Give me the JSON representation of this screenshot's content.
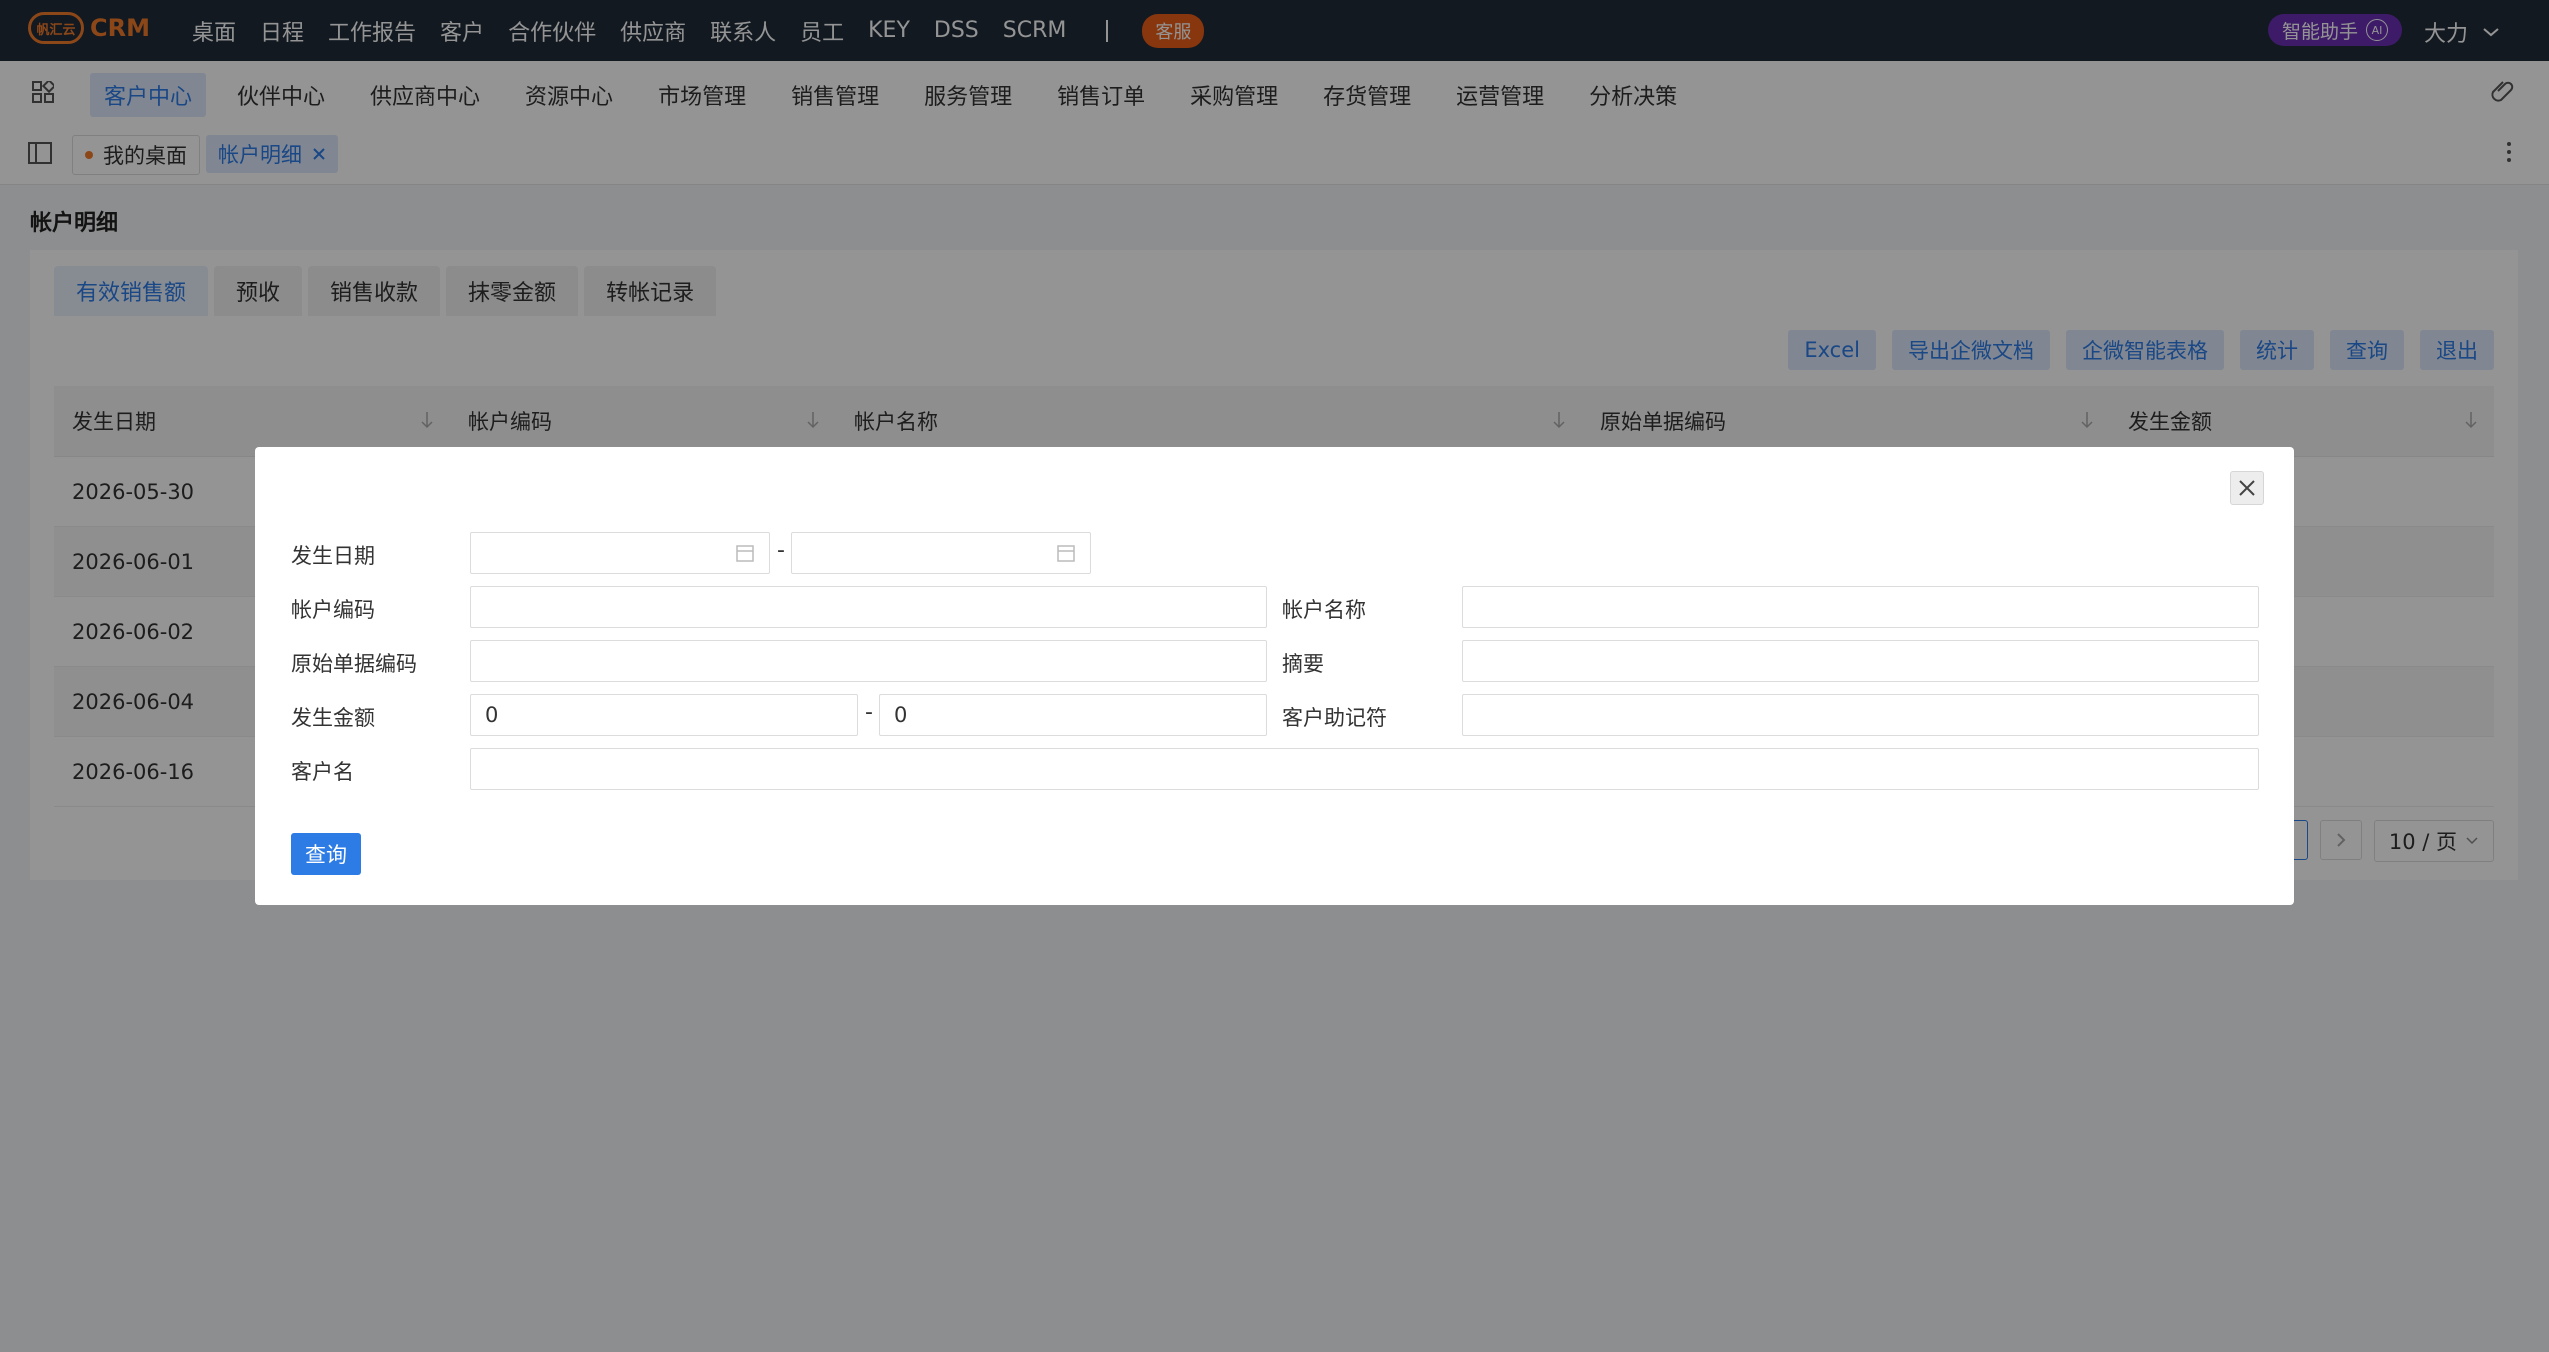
{
  "topbar": {
    "logo_badge": "帆汇云",
    "logo_text": "CRM",
    "nav": [
      "桌面",
      "日程",
      "工作报告",
      "客户",
      "合作伙伴",
      "供应商",
      "联系人",
      "员工",
      "KEY",
      "DSS",
      "SCRM"
    ],
    "kefu": "客服",
    "ai_label": "智能助手",
    "ai_badge": "AI",
    "user_name": "大力"
  },
  "modules": {
    "items": [
      "客户中心",
      "伙伴中心",
      "供应商中心",
      "资源中心",
      "市场管理",
      "销售管理",
      "服务管理",
      "销售订单",
      "采购管理",
      "存货管理",
      "运营管理",
      "分析决策"
    ],
    "active_index": 0
  },
  "page_tabs": {
    "home": "我的桌面",
    "current": "帐户明细"
  },
  "page_title": "帐户明细",
  "content_tabs": [
    "有效销售额",
    "预收",
    "销售收款",
    "抹零金额",
    "转帐记录"
  ],
  "actions": [
    "Excel",
    "导出企微文档",
    "企微智能表格",
    "统计",
    "查询",
    "退出"
  ],
  "table": {
    "columns": [
      "发生日期",
      "帐户编码",
      "帐户名称",
      "原始单据编码",
      "发生金额"
    ],
    "rows": [
      "2026-05-30",
      "2026-06-01",
      "2026-06-02",
      "2026-06-04",
      "2026-06-16"
    ]
  },
  "pager": {
    "page_size": "10 / 页"
  },
  "modal": {
    "labels": {
      "date": "发生日期",
      "account_code": "帐户编码",
      "account_name": "帐户名称",
      "source_code": "原始单据编码",
      "summary": "摘要",
      "amount": "发生金额",
      "customer_mnemonic": "客户助记符",
      "customer_name": "客户名"
    },
    "range_sep": "-",
    "amount_from": "0",
    "amount_to": "0",
    "submit": "查询"
  },
  "colors": {
    "accent": "#2d7be5",
    "topbar": "#1f2b3a",
    "kefu": "#e85d17",
    "ai": "#6b2fb4"
  }
}
